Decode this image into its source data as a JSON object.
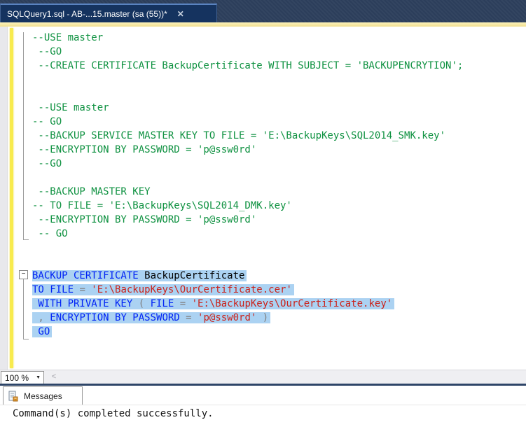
{
  "tab": {
    "title": "SQLQuery1.sql - AB-...15.master (sa (55))*",
    "close_glyph": "✕"
  },
  "editor": {
    "zoom_value": "100 %",
    "zoom_caret_glyph": "▼",
    "collapse_glyph": "−",
    "scroll_left_glyph": "<",
    "lines": [
      {
        "sel": false,
        "tokens": [
          [
            "c",
            "--USE master"
          ]
        ]
      },
      {
        "sel": false,
        "tokens": [
          [
            "c",
            " --GO"
          ]
        ]
      },
      {
        "sel": false,
        "tokens": [
          [
            "c",
            " --CREATE CERTIFICATE BackupCertificate WITH SUBJECT = 'BACKUPENCRYTION';"
          ]
        ]
      },
      {
        "sel": false,
        "tokens": []
      },
      {
        "sel": false,
        "tokens": []
      },
      {
        "sel": false,
        "tokens": [
          [
            "c",
            " --USE master"
          ]
        ]
      },
      {
        "sel": false,
        "tokens": [
          [
            "c",
            "-- GO"
          ]
        ]
      },
      {
        "sel": false,
        "tokens": [
          [
            "c",
            " --BACKUP SERVICE MASTER KEY TO FILE = 'E:\\BackupKeys\\SQL2014_SMK.key'"
          ]
        ]
      },
      {
        "sel": false,
        "tokens": [
          [
            "c",
            " --ENCRYPTION BY PASSWORD = 'p@ssw0rd'"
          ]
        ]
      },
      {
        "sel": false,
        "tokens": [
          [
            "c",
            " --GO"
          ]
        ]
      },
      {
        "sel": false,
        "tokens": []
      },
      {
        "sel": false,
        "tokens": [
          [
            "c",
            " --BACKUP MASTER KEY"
          ]
        ]
      },
      {
        "sel": false,
        "tokens": [
          [
            "c",
            "-- TO FILE = 'E:\\BackupKeys\\SQL2014_DMK.key'"
          ]
        ]
      },
      {
        "sel": false,
        "tokens": [
          [
            "c",
            " --ENCRYPTION BY PASSWORD = 'p@ssw0rd'"
          ]
        ]
      },
      {
        "sel": false,
        "tokens": [
          [
            "c",
            " -- GO"
          ]
        ]
      },
      {
        "sel": false,
        "tokens": []
      },
      {
        "sel": false,
        "tokens": []
      },
      {
        "sel": true,
        "tokens": [
          [
            "k",
            "BACKUP CERTIFICATE "
          ],
          [
            "i",
            "BackupCertificate"
          ]
        ]
      },
      {
        "sel": true,
        "tokens": [
          [
            "k",
            "TO FILE "
          ],
          [
            "o",
            "= "
          ],
          [
            "s",
            "'E:\\BackupKeys\\OurCertificate.cer'"
          ]
        ]
      },
      {
        "sel": true,
        "tokens": [
          [
            "k",
            " WITH PRIVATE KEY "
          ],
          [
            "o",
            "( "
          ],
          [
            "k",
            "FILE "
          ],
          [
            "o",
            "= "
          ],
          [
            "s",
            "'E:\\BackupKeys\\OurCertificate.key'"
          ]
        ]
      },
      {
        "sel": true,
        "tokens": [
          [
            "o",
            " , "
          ],
          [
            "k",
            "ENCRYPTION BY PASSWORD "
          ],
          [
            "o",
            "= "
          ],
          [
            "s",
            "'p@ssw0rd'"
          ],
          [
            "o",
            " )"
          ]
        ]
      },
      {
        "sel": true,
        "tokens": [
          [
            "k",
            " GO"
          ]
        ]
      },
      {
        "sel": false,
        "tokens": []
      },
      {
        "sel": false,
        "tokens": []
      }
    ]
  },
  "messages": {
    "tab_label": "Messages",
    "output": "Command(s) completed successfully."
  },
  "colors": {
    "tab_bar": "#2c3e5b",
    "tab": "#15335f",
    "tab_border": "#5a83c0",
    "strip": "#f7e9a5",
    "selection": "#abd2f2",
    "comment": "#0e9140",
    "keyword": "#0023f5",
    "string": "#cb231b",
    "operator": "#7f7f7f",
    "identifier": "#000000",
    "change_bar": "#f8eb4e",
    "margin": "#e8e8ec",
    "outline": "#9c9c9c",
    "splitter": "#2e4568"
  }
}
